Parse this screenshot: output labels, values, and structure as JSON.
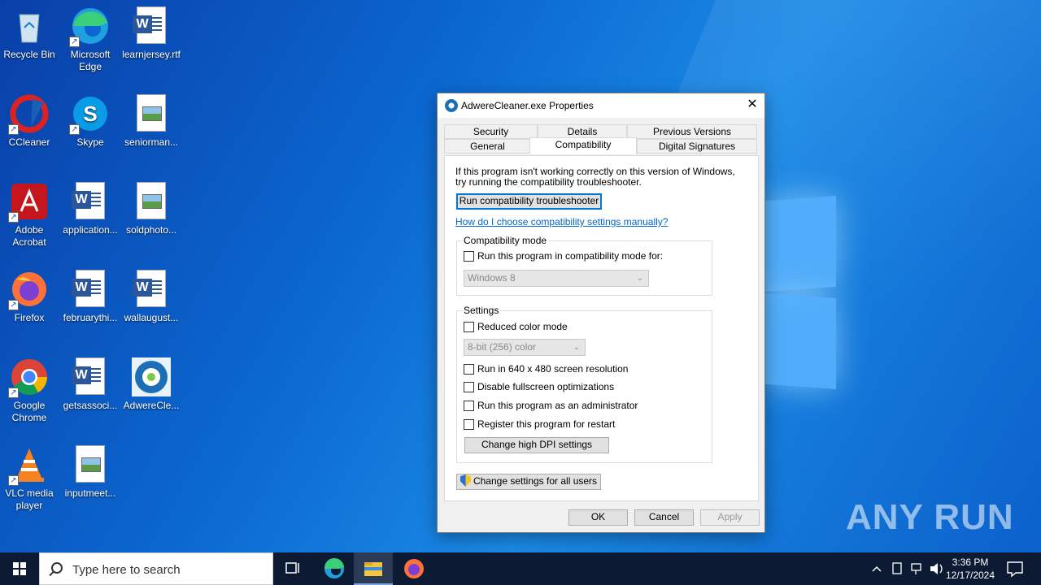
{
  "desktop": {
    "icons": [
      {
        "label": "Recycle Bin",
        "icon": "recycle-bin-icon"
      },
      {
        "label": "Microsoft Edge",
        "icon": "edge-icon"
      },
      {
        "label": "learnjersey.rtf",
        "icon": "word-document-icon"
      },
      {
        "label": "CCleaner",
        "icon": "ccleaner-icon"
      },
      {
        "label": "Skype",
        "icon": "skype-icon"
      },
      {
        "label": "seniorman...",
        "icon": "image-file-icon"
      },
      {
        "label": "Adobe Acrobat",
        "icon": "acrobat-icon"
      },
      {
        "label": "application...",
        "icon": "word-document-icon"
      },
      {
        "label": "soldphoto...",
        "icon": "image-file-icon"
      },
      {
        "label": "Firefox",
        "icon": "firefox-icon"
      },
      {
        "label": "februarythi...",
        "icon": "word-document-icon"
      },
      {
        "label": "wallaugust...",
        "icon": "word-document-icon"
      },
      {
        "label": "Google Chrome",
        "icon": "chrome-icon"
      },
      {
        "label": "getsassoci...",
        "icon": "word-document-icon"
      },
      {
        "label": "AdwereCle...",
        "icon": "adwcleaner-icon"
      },
      {
        "label": "VLC media player",
        "icon": "vlc-icon"
      },
      {
        "label": "inputmeet...",
        "icon": "image-file-icon"
      }
    ],
    "watermark": "ANY RUN"
  },
  "dialog": {
    "title": "AdwereCleaner.exe Properties",
    "close_glyph": "✕",
    "tabs": {
      "security": "Security",
      "details": "Details",
      "previous_versions": "Previous Versions",
      "general": "General",
      "compatibility": "Compatibility",
      "digital_signatures": "Digital Signatures"
    },
    "intro_line1": "If this program isn't working correctly on this version of Windows,",
    "intro_line2": "try running the compatibility troubleshooter.",
    "troubleshooter_button": "Run compatibility troubleshooter",
    "help_link": "How do I choose compatibility settings manually?",
    "compat_mode": {
      "group_label": "Compatibility mode",
      "checkbox_label": "Run this program in compatibility mode for:",
      "checked": false,
      "select_value": "Windows 8"
    },
    "settings": {
      "group_label": "Settings",
      "reduced_color": "Reduced color mode",
      "color_select_value": "8-bit (256) color",
      "res_640": "Run in 640 x 480 screen resolution",
      "disable_fullscreen": "Disable fullscreen optimizations",
      "run_admin": "Run this program as an administrator",
      "register_restart": "Register this program for restart",
      "dpi_button": "Change high DPI settings"
    },
    "all_users_button": "Change settings for all users",
    "ok": "OK",
    "cancel": "Cancel",
    "apply": "Apply"
  },
  "taskbar": {
    "search_placeholder": "Type here to search",
    "time": "3:36 PM",
    "date": "12/17/2024"
  }
}
